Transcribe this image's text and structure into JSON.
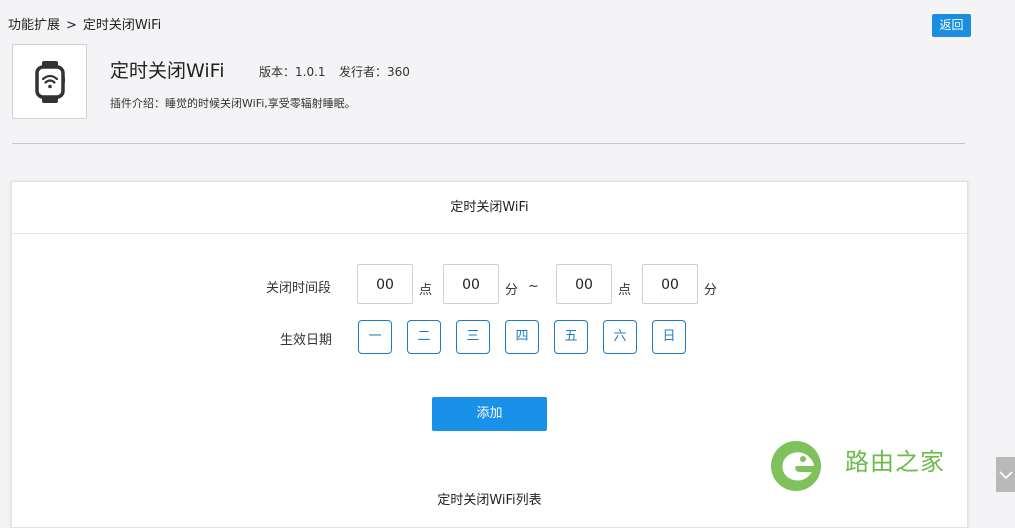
{
  "breadcrumb": {
    "parent": "功能扩展",
    "separator": ">",
    "current": "定时关闭WiFi"
  },
  "back_button": {
    "label": "返回"
  },
  "plugin": {
    "icon": "smartwatch-wifi-icon",
    "title": "定时关闭WiFi",
    "version": "版本：1.0.1",
    "publisher": "发行者：360",
    "description": "插件介绍：睡觉的时候关闭WiFi,享受零辐射睡眠。"
  },
  "panel": {
    "title": "定时关闭WiFi",
    "close_period_label": "关闭时间段",
    "start_hour": "00",
    "start_minute": "00",
    "end_hour": "00",
    "end_minute": "00",
    "hour_unit": "点",
    "minute_unit": "分",
    "range_sep": "~",
    "effective_days_label": "生效日期",
    "days": [
      "一",
      "二",
      "三",
      "四",
      "五",
      "六",
      "日"
    ],
    "add_label": "添加",
    "list_title": "定时关闭WiFi列表"
  },
  "watermark": {
    "text": "路由之家",
    "color": "#6cbb4b"
  },
  "colors": {
    "accent": "#1a91e8",
    "day_border": "#1a7fc4"
  }
}
